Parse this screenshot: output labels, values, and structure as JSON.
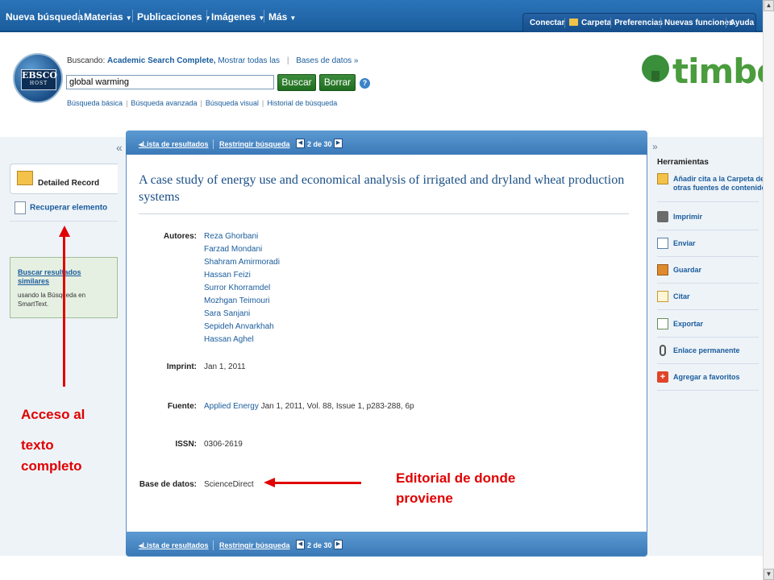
{
  "nav": {
    "items": [
      "Nueva búsqueda",
      "Materias",
      "Publicaciones",
      "Imágenes",
      "Más"
    ],
    "right_tabs": [
      "Conectar",
      "Carpeta",
      "Preferencias",
      "Nuevas funciones",
      "Ayuda"
    ]
  },
  "logo": {
    "line1": "EBSCO",
    "line2": "HOST"
  },
  "search": {
    "prefix": "Buscando: ",
    "database": "Academic Search Complete,",
    "show_all": "Mostrar todas las",
    "databases_link": "Bases de datos »",
    "query": "global warming",
    "search_btn": "Buscar",
    "clear_btn": "Borrar",
    "help": "?",
    "links": [
      "Búsqueda básica",
      "Búsqueda avanzada",
      "Búsqueda visual",
      "Historial de búsqueda"
    ]
  },
  "brand": "timbó",
  "left": {
    "collapse": "«",
    "detailed": "Detailed Record",
    "retrieve": "Recuperar elemento",
    "similar_title": "Buscar resultados similares",
    "similar_desc": "usando la Búsqueda en SmartText."
  },
  "panel": {
    "results_link": "Lista de resultados",
    "refine_link": "Restringir búsqueda",
    "page": "2 de 30",
    "title": "A case study of energy use and economical analysis of irrigated and dryland wheat production systems",
    "authors_label": "Autores:",
    "authors": [
      "Reza Ghorbani",
      "Farzad Mondani",
      "Shahram Amirmoradi",
      "Hassan Feizi",
      "Surror Khorramdel",
      "Mozhgan Teimouri",
      "Sara Sanjani",
      "Sepideh Anvarkhah",
      "Hassan Aghel"
    ],
    "imprint_label": "Imprint:",
    "imprint": "Jan 1, 2011",
    "source_label": "Fuente:",
    "source_journal": "Applied Energy",
    "source_rest": " Jan 1, 2011, Vol. 88, Issue 1, p283-288, 6p",
    "issn_label": "ISSN:",
    "issn": "0306-2619",
    "db_label": "Base de datos:",
    "db": "ScienceDirect"
  },
  "tools": {
    "collapse": "»",
    "title": "Herramientas",
    "items": [
      "Añadir cita a la Carpeta de otras fuentes de contenido",
      "Imprimir",
      "Enviar",
      "Guardar",
      "Citar",
      "Exportar",
      "Enlace permanente",
      "Agregar a favoritos"
    ]
  },
  "annotations": {
    "left_line1": "Acceso al",
    "left_line2": "texto",
    "left_line3": "completo",
    "right_line1": "Editorial de donde",
    "right_line2": "proviene"
  },
  "colors": {
    "nav": "#1a5c9c",
    "annotation": "#e00000",
    "brand_green": "#4a9c3d"
  }
}
